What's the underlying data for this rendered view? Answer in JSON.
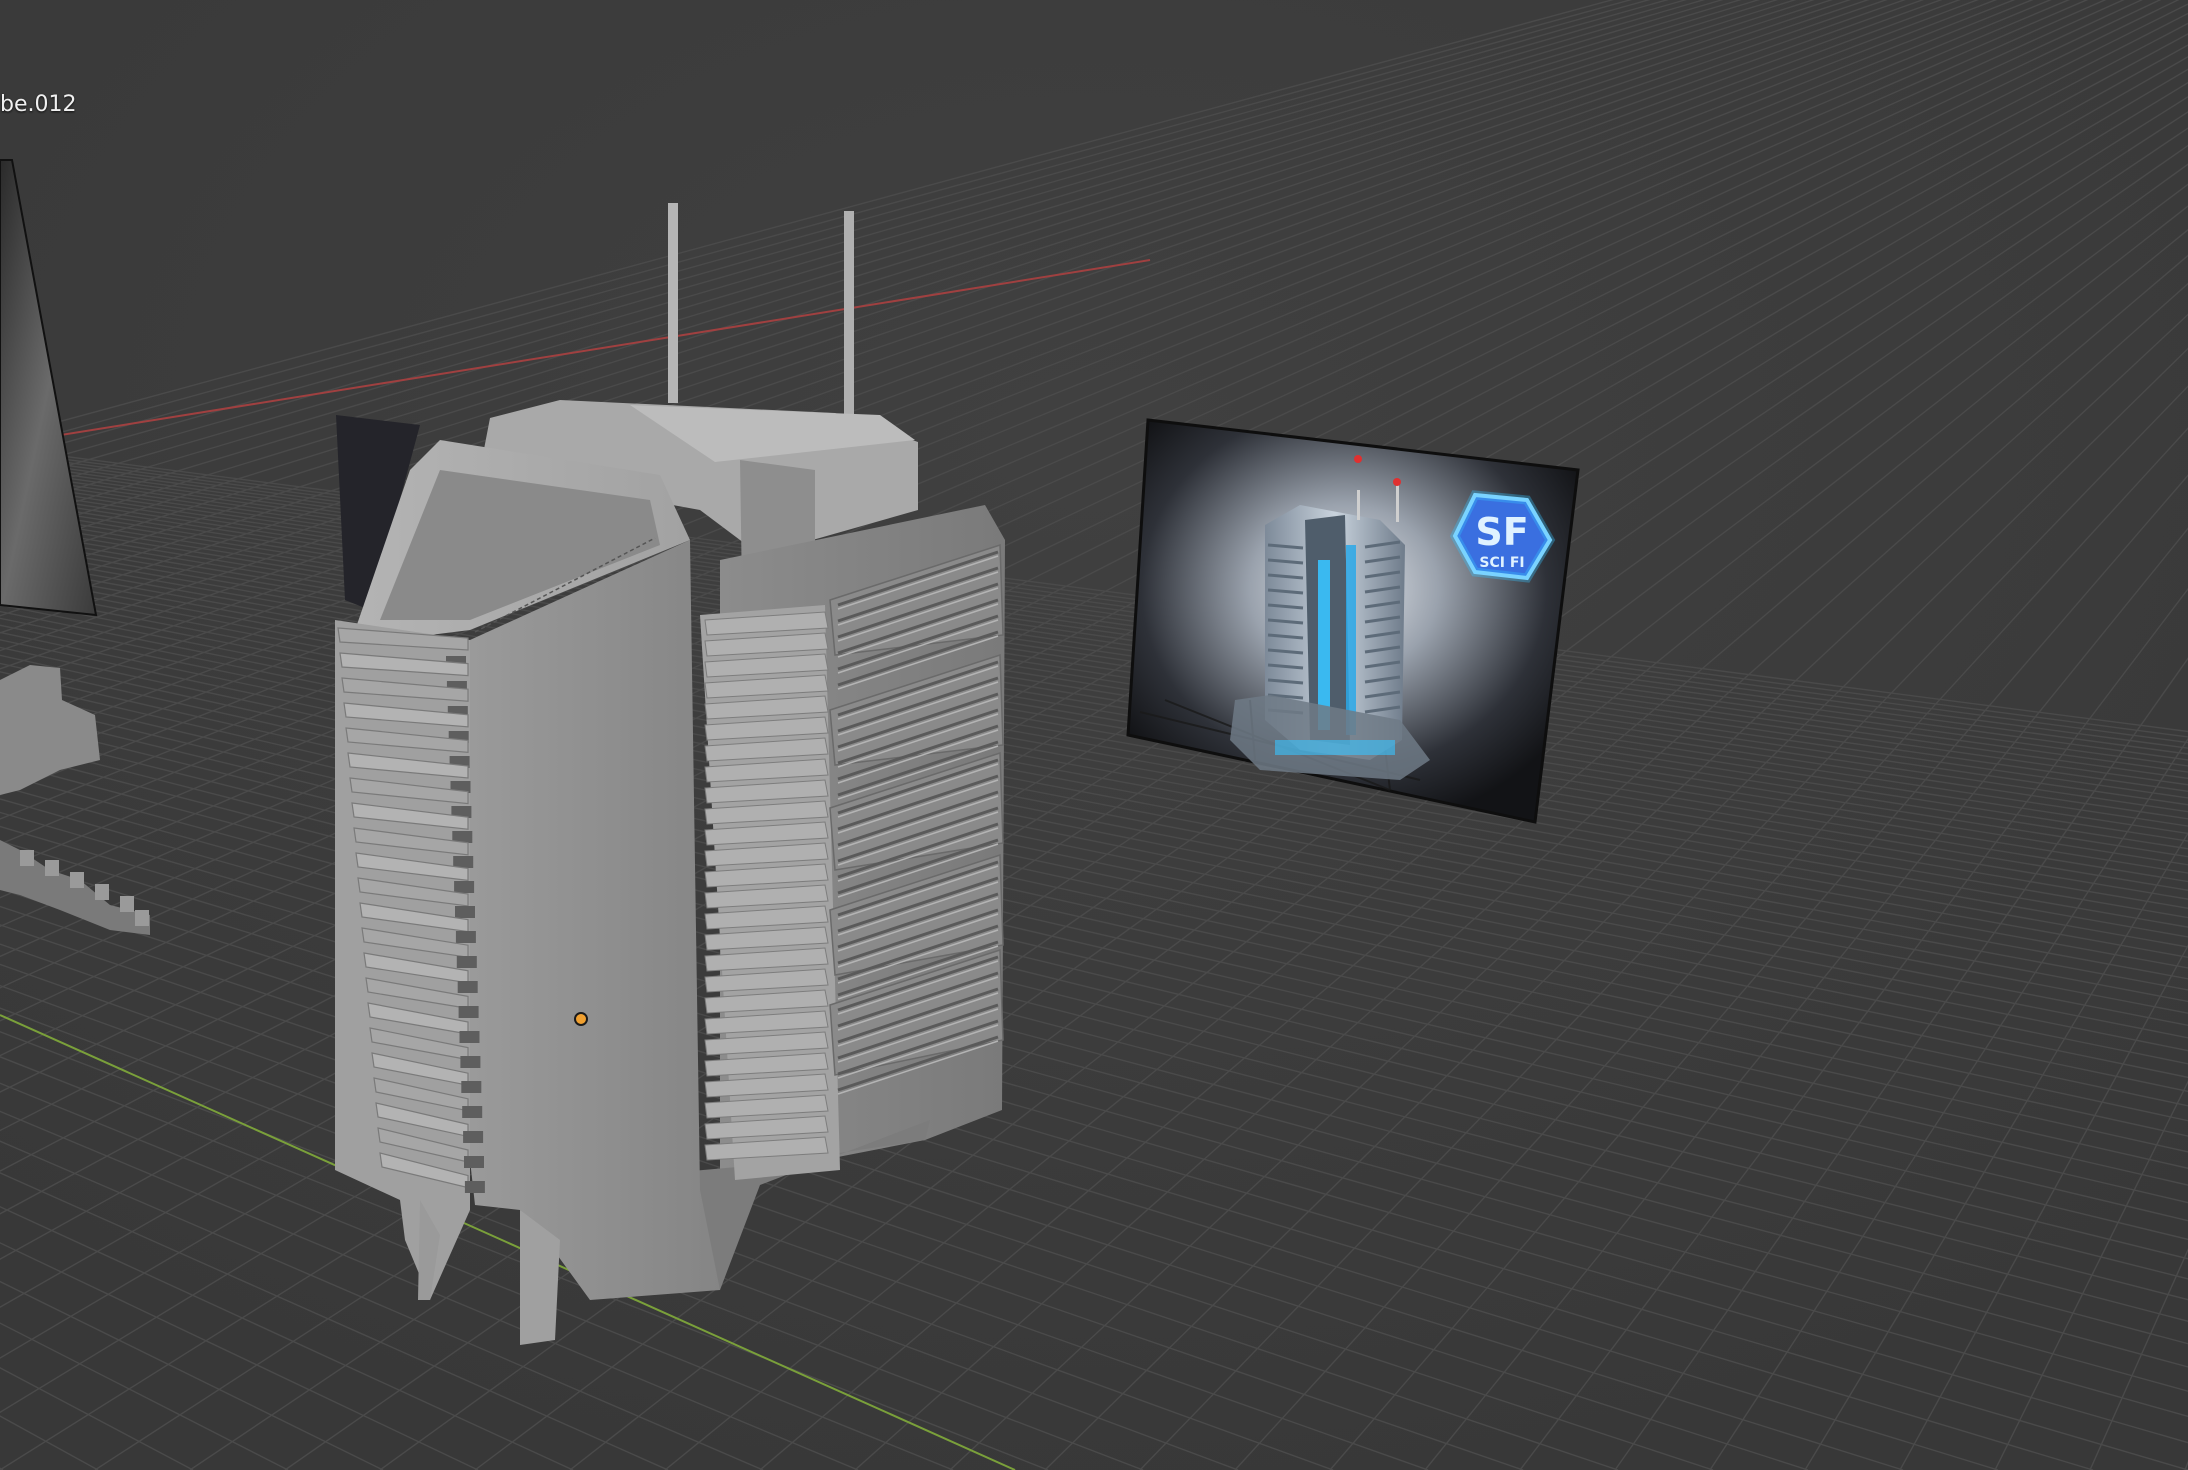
{
  "viewport": {
    "active_object_label": "be.012",
    "background_color": "#3d3d3d",
    "grid_line_color": "#4a4a4a",
    "x_axis_color": "#a04040",
    "y_axis_color": "#7aa03a",
    "origin_color": "#f0a030"
  },
  "reference_image": {
    "badge_line1": "SF",
    "badge_line2": "SCI FI",
    "glow_color": "#37c3ff",
    "badge_color": "#3a6fe0"
  },
  "icons": {
    "origin": "origin-dot-icon"
  }
}
